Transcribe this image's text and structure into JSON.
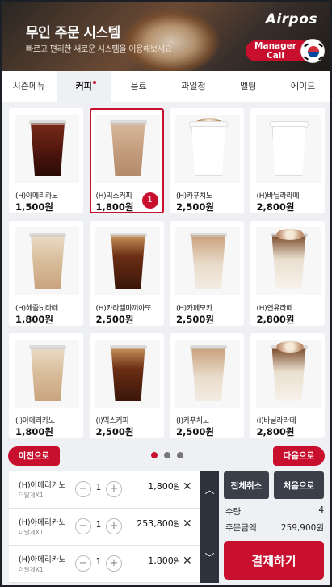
{
  "header": {
    "title": "무인 주문 시스템",
    "subtitle": "빠르고 편리한 새로운 시스템을 이용해보세요",
    "logo": "Airpos",
    "manager_call": "Manager Call",
    "language_flag": "korea-flag-icon"
  },
  "tabs": [
    {
      "label": "시즌메뉴",
      "active": false
    },
    {
      "label": "커피",
      "active": true,
      "has_dot": true
    },
    {
      "label": "음료",
      "active": false
    },
    {
      "label": "과일청",
      "active": false
    },
    {
      "label": "멜팅",
      "active": false
    },
    {
      "label": "에이드",
      "active": false
    }
  ],
  "menu": [
    {
      "name": "(H)아메리카노",
      "price": "1,500원",
      "drink": "iced-americano-cup"
    },
    {
      "name": "(H)믹스커피",
      "price": "1,800원",
      "drink": "mix-coffee-cup",
      "selected": true,
      "qty": "1"
    },
    {
      "name": "(H)카푸치노",
      "price": "2,500원",
      "drink": "paper-cup-cappuccino"
    },
    {
      "name": "(H)바닐라라떼",
      "price": "2,800원",
      "drink": "paper-cup-latte"
    },
    {
      "name": "(H)헤즐넛라떼",
      "price": "1,800원",
      "drink": "iced-latte-cup"
    },
    {
      "name": "(H)카라멜마끼아또",
      "price": "2,500원",
      "drink": "iced-caramel-cup"
    },
    {
      "name": "(H)카페모카",
      "price": "2,500원",
      "drink": "iced-mocha-cup"
    },
    {
      "name": "(H)연유라떼",
      "price": "2,800원",
      "drink": "iced-condensed-latte-cup"
    },
    {
      "name": "(I)아메리카노",
      "price": "1,800원",
      "drink": "iced-latte-cup"
    },
    {
      "name": "(I)믹스커피",
      "price": "2,500원",
      "drink": "iced-caramel-cup"
    },
    {
      "name": "(I)카푸치노",
      "price": "2,500원",
      "drink": "iced-mocha-cup"
    },
    {
      "name": "(I)바닐라라떼",
      "price": "2,800원",
      "drink": "iced-condensed-latte-cup"
    }
  ],
  "pager": {
    "prev": "이전으로",
    "next": "다음으로",
    "pages": 3,
    "current": 1
  },
  "cart": [
    {
      "name": "(H)아메리카노",
      "option": "더달게X1",
      "qty": "1",
      "price": "1,800",
      "unit": "원"
    },
    {
      "name": "(H)아메리카노",
      "option": "더달게X1",
      "qty": "1",
      "price": "253,800",
      "unit": "원"
    },
    {
      "name": "(H)아메리카노",
      "option": "더달게X1",
      "qty": "1",
      "price": "1,800",
      "unit": "원"
    }
  ],
  "summary": {
    "cancel_all": "전체취소",
    "go_first": "처음으로",
    "qty_label": "수량",
    "qty_value": "4",
    "total_label": "주문금액",
    "total_value": "259,900원",
    "pay": "결제하기"
  },
  "colors": {
    "accent": "#c8102e",
    "dark": "#3a3f49"
  }
}
